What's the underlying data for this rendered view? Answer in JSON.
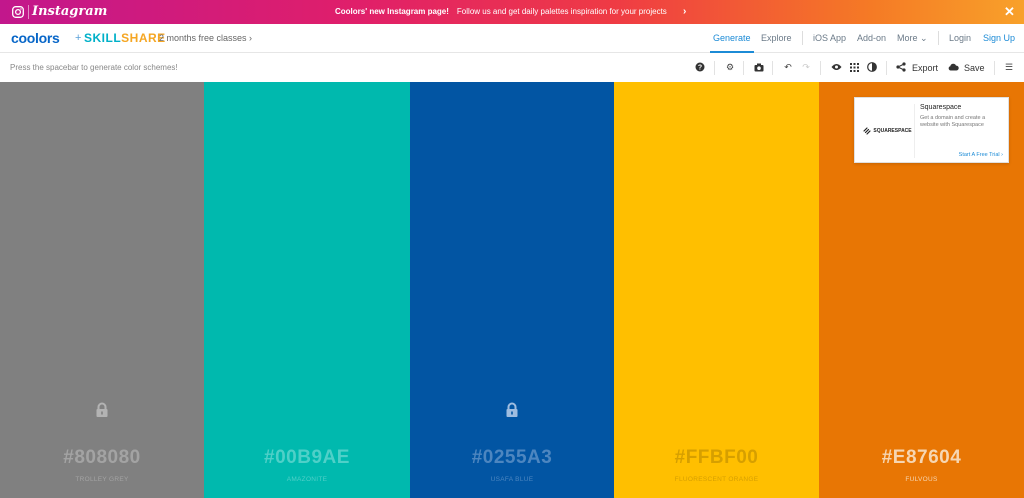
{
  "banner": {
    "brand": "Instagram",
    "bold_text": "Coolors' new Instagram page!",
    "text": "Follow us and get daily palettes inspiration for your projects",
    "arrow": "›",
    "close": "✕",
    "icons": [
      "instagram-icon",
      "chevron-right-icon",
      "close-icon"
    ]
  },
  "nav": {
    "logo": "coolors",
    "plus": "+",
    "partner_a": "SKILL",
    "partner_b": "SHARE",
    "promo": "2 months free classes ›",
    "items": {
      "generate": "Generate",
      "explore": "Explore",
      "ios": "iOS App",
      "addon": "Add-on",
      "more": "More ⌄",
      "login": "Login",
      "signup": "Sign Up"
    }
  },
  "toolbar": {
    "hint": "Press the spacebar to generate color schemes!",
    "export": "Export",
    "save": "Save",
    "icons": {
      "help": "?",
      "settings": "⚙",
      "camera": "◉",
      "undo": "↶",
      "redo": "↷",
      "eye": "◉",
      "grid": "▦",
      "contrast": "◐",
      "share": "⋖",
      "cloud": "☁",
      "menu": "☰"
    }
  },
  "swatches": [
    {
      "hex": "#808080",
      "name": "TROLLEY GREY",
      "bg": "#808080",
      "text": "#a3a3a3",
      "locked": true
    },
    {
      "hex": "#00B9AE",
      "name": "AMAZONITE",
      "bg": "#00b9ae",
      "text": "#4fd0c8",
      "locked": false
    },
    {
      "hex": "#0255A3",
      "name": "USAFA BLUE",
      "bg": "#0255a3",
      "text": "#4d86c0",
      "locked": true
    },
    {
      "hex": "#FFBF00",
      "name": "FLUORESCENT ORANGE",
      "bg": "#ffbf00",
      "text": "#d69f00",
      "locked": false
    },
    {
      "hex": "#E87604",
      "name": "FULVOUS",
      "bg": "#e87604",
      "text": "#f6d6b2",
      "locked": false
    }
  ],
  "ad": {
    "logo": "SQUARESPACE",
    "title": "Squarespace",
    "desc": "Get a domain and create a website with Squarespace",
    "cta": "Start A Free Trial ›"
  }
}
